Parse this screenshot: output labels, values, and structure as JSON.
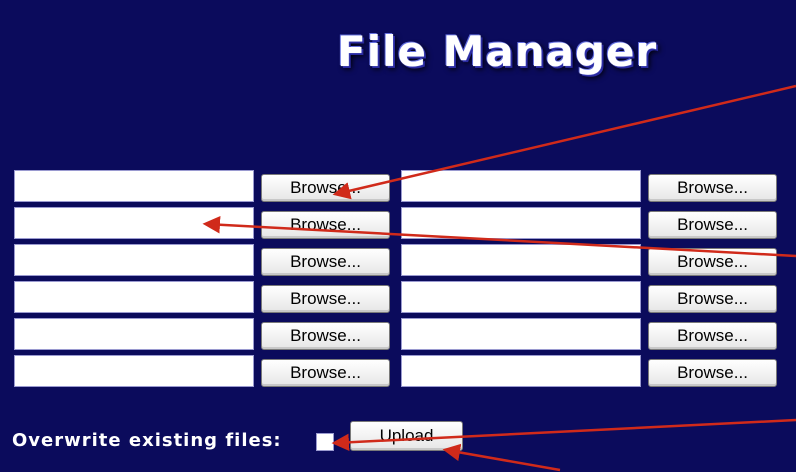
{
  "header": {
    "title": "File Manager"
  },
  "upload": {
    "browse_label": "Browse...",
    "rows": [
      {
        "left_value": "",
        "right_value": ""
      },
      {
        "left_value": "",
        "right_value": ""
      },
      {
        "left_value": "",
        "right_value": ""
      },
      {
        "left_value": "",
        "right_value": ""
      },
      {
        "left_value": "",
        "right_value": ""
      },
      {
        "left_value": "",
        "right_value": ""
      }
    ],
    "overwrite_label": "Overwrite existing files:",
    "overwrite_checked": false,
    "upload_button_label": "Upload"
  },
  "colors": {
    "background": "#0b0b5c",
    "annotation_arrow": "#d02a1a"
  }
}
